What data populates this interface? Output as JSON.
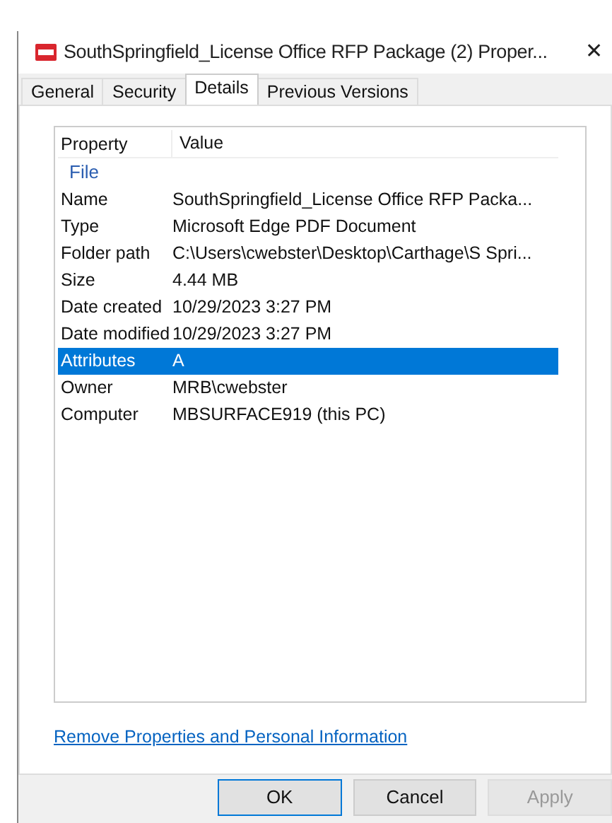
{
  "window": {
    "title": "SouthSpringfield_License Office RFP Package (2) Proper...",
    "close": "✕"
  },
  "tabs": [
    {
      "label": "General",
      "selected": false
    },
    {
      "label": "Security",
      "selected": false
    },
    {
      "label": "Details",
      "selected": true
    },
    {
      "label": "Previous Versions",
      "selected": false
    }
  ],
  "table": {
    "columns": [
      "Property",
      "Value"
    ],
    "group": "File",
    "rows": [
      {
        "property": "Name",
        "value": "SouthSpringfield_License Office RFP Packa...",
        "selected": false
      },
      {
        "property": "Type",
        "value": "Microsoft Edge PDF Document",
        "selected": false
      },
      {
        "property": "Folder path",
        "value": "C:\\Users\\cwebster\\Desktop\\Carthage\\S Spri...",
        "selected": false
      },
      {
        "property": "Size",
        "value": "4.44 MB",
        "selected": false
      },
      {
        "property": "Date created",
        "value": "10/29/2023 3:27 PM",
        "selected": false
      },
      {
        "property": "Date modified",
        "value": "10/29/2023 3:27 PM",
        "selected": false
      },
      {
        "property": "Attributes",
        "value": "A",
        "selected": true
      },
      {
        "property": "Owner",
        "value": "MRB\\cwebster",
        "selected": false
      },
      {
        "property": "Computer",
        "value": "MBSURFACE919 (this PC)",
        "selected": false
      }
    ]
  },
  "link": "Remove Properties and Personal Information",
  "buttons": [
    {
      "label": "OK",
      "default": true,
      "disabled": false
    },
    {
      "label": "Cancel",
      "default": false,
      "disabled": false
    },
    {
      "label": "Apply",
      "default": false,
      "disabled": true
    }
  ]
}
